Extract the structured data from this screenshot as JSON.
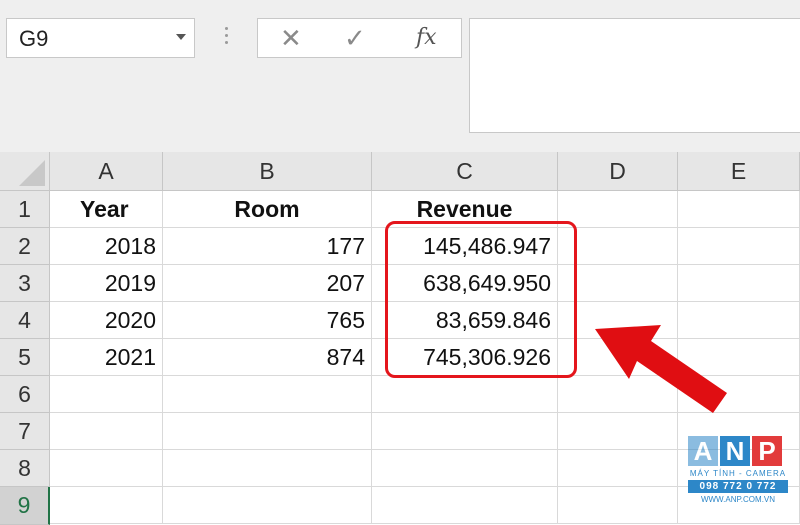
{
  "formula_bar": {
    "name_box": "G9",
    "cancel_icon": "close-icon",
    "enter_icon": "check-icon",
    "fx_label": "fx",
    "content": ""
  },
  "columns": [
    "A",
    "B",
    "C",
    "D",
    "E"
  ],
  "rows": [
    "1",
    "2",
    "3",
    "4",
    "5",
    "6",
    "7",
    "8",
    "9"
  ],
  "cells": {
    "r1": [
      "Year",
      "Room",
      "Revenue",
      "",
      ""
    ],
    "r2": [
      "2018",
      "177",
      "145,486.947",
      "",
      ""
    ],
    "r3": [
      "2019",
      "207",
      "638,649.950",
      "",
      ""
    ],
    "r4": [
      "2020",
      "765",
      "83,659.846",
      "",
      ""
    ],
    "r5": [
      "2021",
      "874",
      "745,306.926",
      "",
      ""
    ]
  },
  "selected_row": "9",
  "annotation": {
    "highlight_color": "#e4161c",
    "arrow_color": "#e00e12"
  },
  "watermark": {
    "letters": [
      "A",
      "N",
      "P"
    ],
    "tagline": "MÁY TÍNH - CAMERA",
    "phone": "098 772 0 772",
    "website": "WWW.ANP.COM.VN"
  }
}
